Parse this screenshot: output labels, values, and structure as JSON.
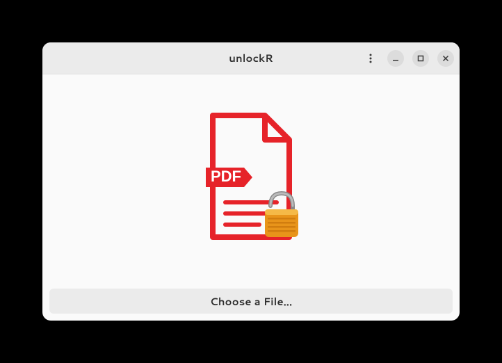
{
  "header": {
    "title": "unlockR"
  },
  "footer": {
    "choose_file_label": "Choose a File..."
  }
}
